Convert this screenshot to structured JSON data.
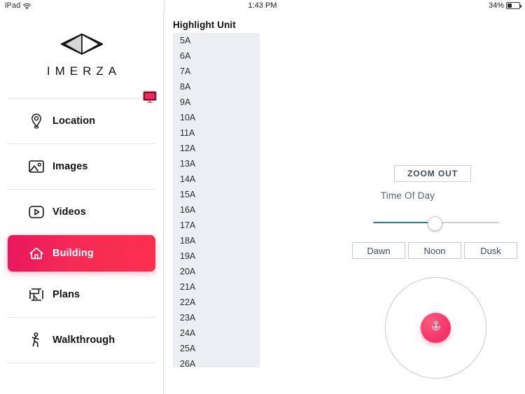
{
  "statusbar": {
    "device": "iPad",
    "wifi_icon": "wifi-icon",
    "time": "1:43 PM",
    "battery_percent": "34%",
    "battery_icon": "battery-icon"
  },
  "sidebar": {
    "brand_name": "IMERZA",
    "brand_logo_icon": "imerza-diamond-logo",
    "monitor_icon": "monitor-icon",
    "items": [
      {
        "label": "Location",
        "icon": "map-pin-icon",
        "active": false
      },
      {
        "label": "Images",
        "icon": "image-icon",
        "active": false
      },
      {
        "label": "Videos",
        "icon": "play-square-icon",
        "active": false
      },
      {
        "label": "Building",
        "icon": "home-icon",
        "active": true
      },
      {
        "label": "Plans",
        "icon": "floorplan-icon",
        "active": false
      },
      {
        "label": "Walkthrough",
        "icon": "walking-person-icon",
        "active": false
      }
    ],
    "active_item": "Building"
  },
  "unit_panel": {
    "title": "Highlight Unit",
    "units": [
      "5A",
      "6A",
      "7A",
      "8A",
      "9A",
      "10A",
      "11A",
      "12A",
      "13A",
      "14A",
      "15A",
      "16A",
      "17A",
      "18A",
      "19A",
      "20A",
      "21A",
      "22A",
      "23A",
      "24A",
      "25A",
      "26A"
    ]
  },
  "controls": {
    "zoom_out_label": "ZOOM OUT",
    "time_of_day_label": "Time Of Day",
    "slider": {
      "value": 50,
      "min": 0,
      "max": 100
    },
    "time_buttons": [
      {
        "label": "Dawn"
      },
      {
        "label": "Noon"
      },
      {
        "label": "Dusk"
      }
    ],
    "joystick_icon": "person-navigate-icon"
  },
  "colors": {
    "accent_start": "#e8175d",
    "accent_end": "#fb2f4e",
    "slider_blue": "#1f78e8",
    "list_bg": "#eceef3",
    "button_text": "#3f4b5b"
  }
}
